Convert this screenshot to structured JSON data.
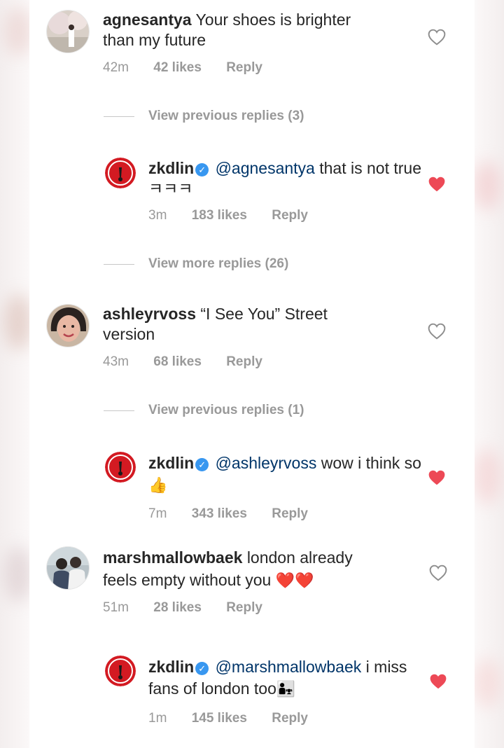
{
  "comments": [
    {
      "username": "agnesantya",
      "text": "Your shoes is brighter than my future",
      "time": "42m",
      "likes": "42 likes",
      "reply": "Reply",
      "liked": false
    },
    {
      "view_replies": "View previous replies (3)"
    },
    {
      "username": "zkdlin",
      "mention": "@agnesantya",
      "text": "that is not true ㅋㅋㅋ",
      "time": "3m",
      "likes": "183 likes",
      "reply": "Reply",
      "liked": true
    },
    {
      "view_replies": "View more replies (26)"
    },
    {
      "username": "ashleyrvoss",
      "text": "“I See You” Street version",
      "time": "43m",
      "likes": "68 likes",
      "reply": "Reply",
      "liked": false
    },
    {
      "view_replies": "View previous replies (1)"
    },
    {
      "username": "zkdlin",
      "mention": "@ashleyrvoss",
      "text": "wow i think so",
      "emoji": "👍",
      "time": "7m",
      "likes": "343 likes",
      "reply": "Reply",
      "liked": true
    },
    {
      "username": "marshmallowbaek",
      "text": "london already feels empty without you",
      "emoji": "❤️❤️",
      "time": "51m",
      "likes": "28 likes",
      "reply": "Reply",
      "liked": false
    },
    {
      "username": "zkdlin",
      "mention": "@marshmallowbaek",
      "text": "i miss fans of london too",
      "emoji": "👨‍👧",
      "time": "1m",
      "likes": "145 likes",
      "reply": "Reply",
      "liked": true
    }
  ],
  "colors": {
    "text": "#262626",
    "meta": "#999999",
    "mention": "#003569",
    "liked_heart": "#ed4956",
    "verified": "#3897f0"
  },
  "icons": {
    "verified": "verified-badge-icon",
    "like_outline": "heart-outline-icon",
    "like_filled": "heart-filled-icon"
  }
}
